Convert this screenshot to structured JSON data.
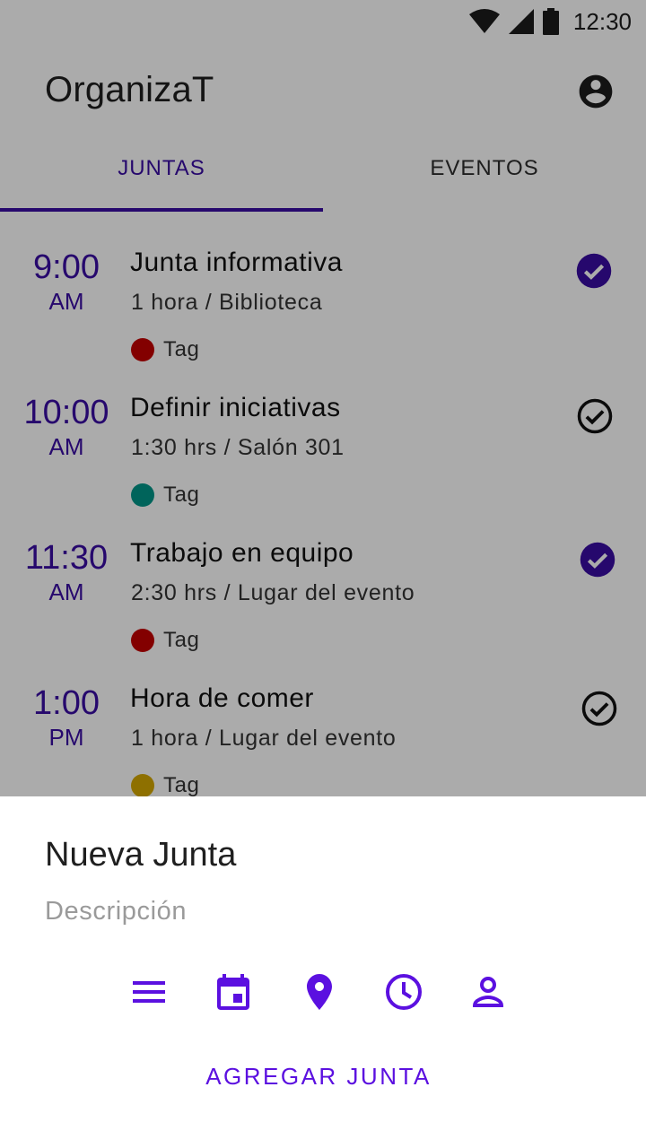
{
  "status_bar": {
    "time": "12:30"
  },
  "app": {
    "title": "OrganizaT"
  },
  "tabs": [
    {
      "label": "JUNTAS",
      "selected": true
    },
    {
      "label": "EVENTOS",
      "selected": false
    }
  ],
  "meetings": [
    {
      "time": "9:00",
      "period": "AM",
      "title": "Junta informativa",
      "subtitle": "1 hora / Biblioteca",
      "tag": "Tag",
      "tag_color": "#c40000",
      "done": true
    },
    {
      "time": "10:00",
      "period": "AM",
      "title": "Definir iniciativas",
      "subtitle": "1:30 hrs / Salón 301",
      "tag": "Tag",
      "tag_color": "#009688",
      "done": false
    },
    {
      "time": "11:30",
      "period": "AM",
      "title": "Trabajo en equipo",
      "subtitle": "2:30 hrs / Lugar del evento",
      "tag": "Tag",
      "tag_color": "#c40000",
      "done": true
    },
    {
      "time": "1:00",
      "period": "PM",
      "title": "Hora de comer",
      "subtitle": "1 hora / Lugar del evento",
      "tag": "Tag",
      "tag_color": "#d4a800",
      "done": false
    }
  ],
  "sheet": {
    "title": "Nueva Junta",
    "description_placeholder": "Descripción",
    "icons": [
      "notes-icon",
      "calendar-icon",
      "location-pin-icon",
      "clock-icon",
      "person-icon"
    ],
    "add_label": "AGREGAR JUNTA"
  },
  "colors": {
    "accent": "#3a0ca3",
    "accent_bright": "#5b10e0",
    "scrim": "rgba(0,0,0,0.33)"
  }
}
